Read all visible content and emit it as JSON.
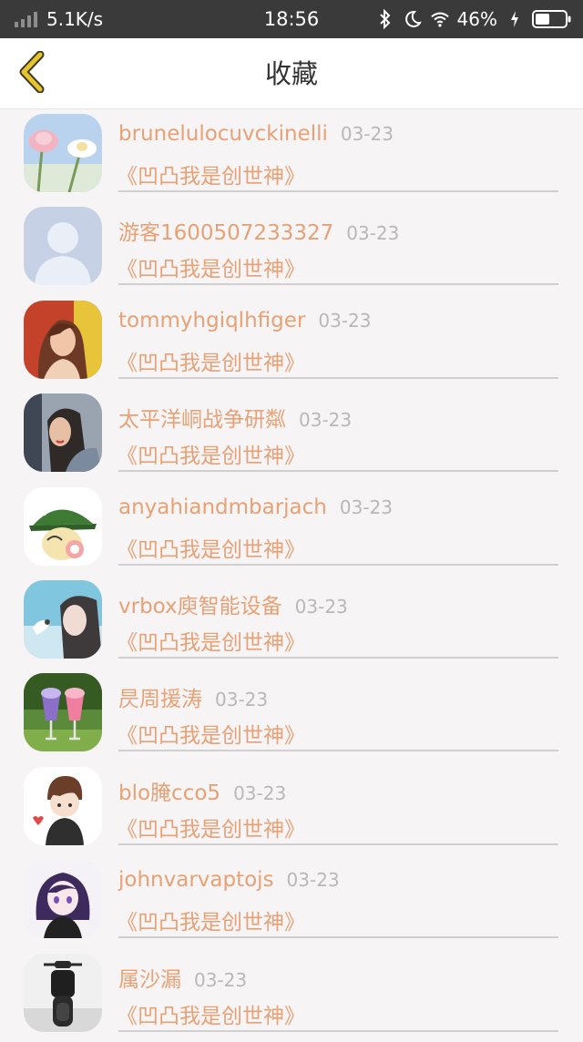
{
  "status_bar": {
    "network_speed": "5.1K/s",
    "time": "18:56",
    "battery_percent": "46%",
    "icons": [
      "signal-icon",
      "bluetooth-icon",
      "moon-icon",
      "wifi-icon",
      "charging-icon",
      "battery-icon"
    ]
  },
  "header": {
    "title": "收藏",
    "back_icon": "chevron-left-icon"
  },
  "colors": {
    "accent": "#e8a175",
    "date": "#b8b8b8",
    "back_icon": "#e7c331"
  },
  "items": [
    {
      "name": "brunelulocuvckinelli",
      "date": "03-23",
      "title": "《凹凸我是创世神》",
      "avatar": "flower-photo"
    },
    {
      "name": "游客1600507233327",
      "date": "03-23",
      "title": "《凹凸我是创世神》",
      "avatar": "default-person"
    },
    {
      "name": "tommyhgiqlhfiger",
      "date": "03-23",
      "title": "《凹凸我是创世神》",
      "avatar": "girl-photo"
    },
    {
      "name": "太平洋峒战争研粼",
      "date": "03-23",
      "title": "《凹凸我是创世神》",
      "avatar": "woman-photo"
    },
    {
      "name": "anyahiandmbarjach",
      "date": "03-23",
      "title": "《凹凸我是创世神》",
      "avatar": "cartoon-hat"
    },
    {
      "name": "vrbox庾智能设备",
      "date": "03-23",
      "title": "《凹凸我是创世神》",
      "avatar": "woman-bird-photo"
    },
    {
      "name": "昃周援涛",
      "date": "03-23",
      "title": "《凹凸我是创世神》",
      "avatar": "drinks-photo"
    },
    {
      "name": "blo腌cco5",
      "date": "03-23",
      "title": "《凹凸我是创世神》",
      "avatar": "cartoon-boy"
    },
    {
      "name": "johnvarvaptojs",
      "date": "03-23",
      "title": "《凹凸我是创世神》",
      "avatar": "anime-girl"
    },
    {
      "name": "属沙漏",
      "date": "03-23",
      "title": "《凹凸我是创世神》",
      "avatar": "motorcycle-photo"
    }
  ]
}
